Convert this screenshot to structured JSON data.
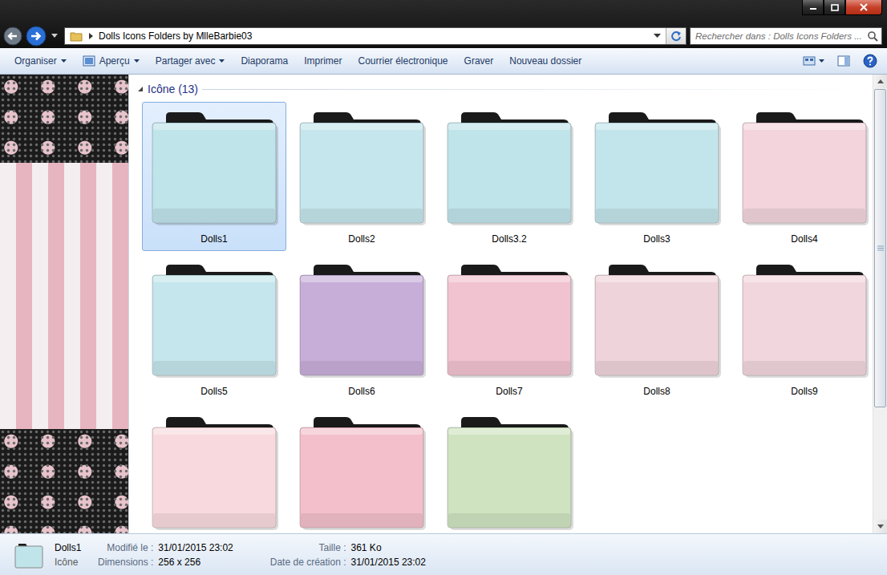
{
  "address": {
    "path": "Dolls Icons Folders  by MlleBarbie03"
  },
  "search": {
    "placeholder": "Rechercher dans : Dolls Icons Folders ..."
  },
  "toolbar": [
    {
      "label": "Organiser",
      "kind": "menu"
    },
    {
      "label": "Aperçu",
      "kind": "icon-menu"
    },
    {
      "label": "Partager avec",
      "kind": "menu"
    },
    {
      "label": "Diaporama",
      "kind": "button"
    },
    {
      "label": "Imprimer",
      "kind": "button"
    },
    {
      "label": "Courrier électronique",
      "kind": "button"
    },
    {
      "label": "Graver",
      "kind": "button"
    },
    {
      "label": "Nouveau dossier",
      "kind": "button"
    }
  ],
  "group": {
    "label": "Icône (13)",
    "expanded": true
  },
  "items": [
    {
      "label": "Dolls1",
      "selected": true,
      "color": "#bfe4ea"
    },
    {
      "label": "Dolls2",
      "selected": false,
      "color": "#c4e6ec"
    },
    {
      "label": "Dolls3.2",
      "selected": false,
      "color": "#bfe4ea"
    },
    {
      "label": "Dolls3",
      "selected": false,
      "color": "#c2e5eb"
    },
    {
      "label": "Dolls4",
      "selected": false,
      "color": "#f3d4dc"
    },
    {
      "label": "Dolls5",
      "selected": false,
      "color": "#c4e6ec"
    },
    {
      "label": "Dolls6",
      "selected": false,
      "color": "#c7aed9"
    },
    {
      "label": "Dolls7",
      "selected": false,
      "color": "#f1c2cf"
    },
    {
      "label": "Dolls8",
      "selected": false,
      "color": "#eed3da"
    },
    {
      "label": "Dolls9",
      "selected": false,
      "color": "#f2d6dd"
    },
    {
      "selected": false,
      "color": "#f8dade"
    },
    {
      "selected": false,
      "color": "#f3bfcb"
    },
    {
      "selected": false,
      "color": "#cfe3c0"
    }
  ],
  "scrollbar": {
    "level": 0.74
  },
  "details": {
    "name": "Dolls1",
    "type": "Icône",
    "fields": [
      {
        "label": "Modifié le :",
        "value": "31/01/2015 23:02"
      },
      {
        "label": "Taille :",
        "value": "361 Ko"
      },
      {
        "label": "Dimensions :",
        "value": "256 x 256"
      },
      {
        "label": "Date de création :",
        "value": "31/01/2015 23:02"
      }
    ]
  }
}
